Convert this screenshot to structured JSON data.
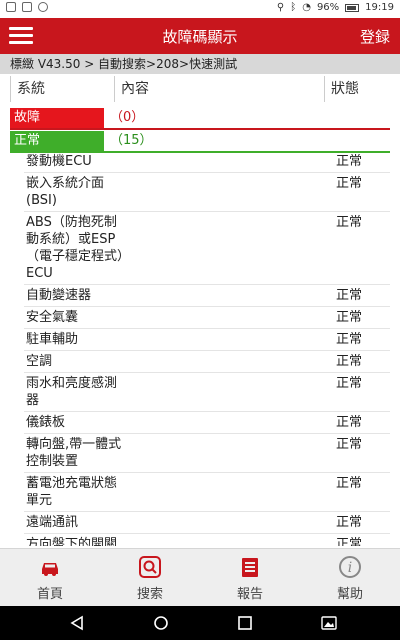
{
  "status_bar": {
    "battery": "96%",
    "time": "19:19"
  },
  "header": {
    "title": "故障碼顯示",
    "login_label": "登録"
  },
  "breadcrumb": "標緻 V43.50 > 自動搜索>208>快速測試",
  "columns": {
    "system": "系統",
    "content": "內容",
    "status": "狀態"
  },
  "summary": {
    "fault_label": "故障",
    "fault_count": "（0）",
    "normal_label": "正常",
    "normal_count": "（15）"
  },
  "items": [
    {
      "name": "發動機ECU",
      "status": "正常"
    },
    {
      "name": "嵌入系統介面(BSI)",
      "status": "正常"
    },
    {
      "name": "ABS（防抱死制動系統）或ESP（電子穩定程式）ECU",
      "status": "正常"
    },
    {
      "name": "自動變速器",
      "status": "正常"
    },
    {
      "name": "安全氣囊",
      "status": "正常"
    },
    {
      "name": "駐車輔助",
      "status": "正常"
    },
    {
      "name": "空調",
      "status": "正常"
    },
    {
      "name": "雨水和亮度感測器",
      "status": "正常"
    },
    {
      "name": "儀錶板",
      "status": "正常"
    },
    {
      "name": "轉向盤,帶一體式控制裝置",
      "status": "正常"
    },
    {
      "name": "蓄電池充電狀態單元",
      "status": "正常"
    },
    {
      "name": "遠端通訊",
      "status": "正常"
    },
    {
      "name": "方向盤下的開關模組",
      "status": "正常"
    }
  ],
  "bottom_nav": [
    {
      "label": "首頁",
      "icon": "car-icon"
    },
    {
      "label": "搜索",
      "icon": "search-icon"
    },
    {
      "label": "報告",
      "icon": "report-icon"
    },
    {
      "label": "幫助",
      "icon": "help-icon"
    }
  ],
  "colors": {
    "brand": "#c8161d",
    "fault": "#e5161d",
    "normal": "#3fae2a"
  }
}
